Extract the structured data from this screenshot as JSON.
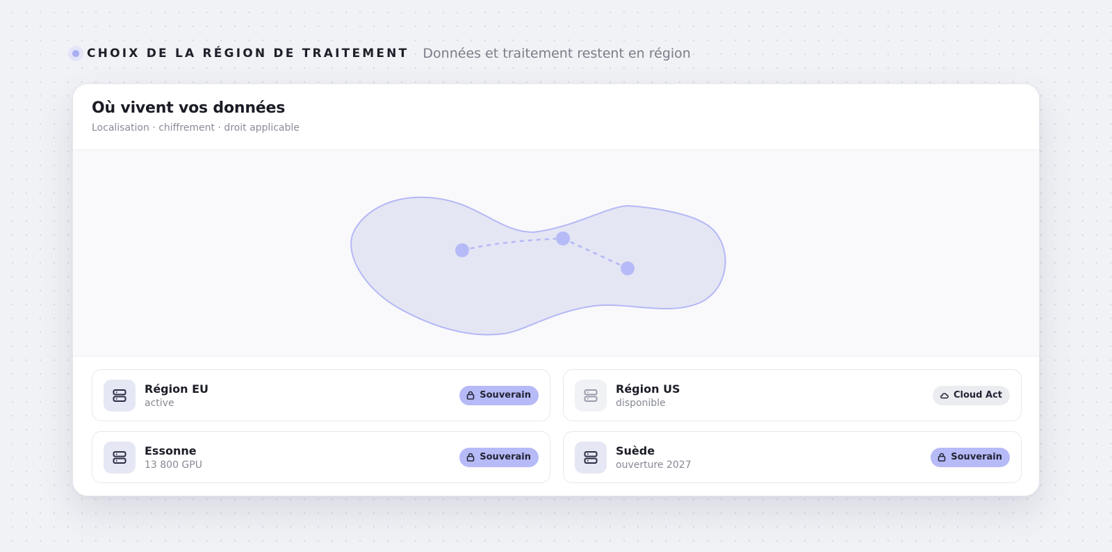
{
  "header": {
    "title": "CHOIX DE LA RÉGION DE TRAITEMENT",
    "subtitle": "Données et traitement restent en région"
  },
  "card": {
    "title": "Où vivent vos données",
    "subtitle": "Localisation · chiffrement · droit applicable"
  },
  "colors": {
    "accent": "#b6baf7",
    "map_fill": "#e4e6f4",
    "map_stroke": "#b4b8f5",
    "node": "#b6baf7"
  },
  "regions": [
    {
      "name": "Région EU",
      "status": "active",
      "badge": "Souverain",
      "badge_icon": "lock-icon",
      "icon": "server-icon"
    },
    {
      "name": "Région US",
      "status": "disponible",
      "badge": "Cloud Act",
      "badge_icon": "cloud-icon",
      "icon": "server-icon"
    },
    {
      "name": "Essonne",
      "status": "13 800 GPU",
      "badge": "Souverain",
      "badge_icon": "lock-icon",
      "icon": "server-icon"
    },
    {
      "name": "Suède",
      "status": "ouverture 2027",
      "badge": "Souverain",
      "badge_icon": "lock-icon",
      "icon": "server-icon"
    }
  ]
}
